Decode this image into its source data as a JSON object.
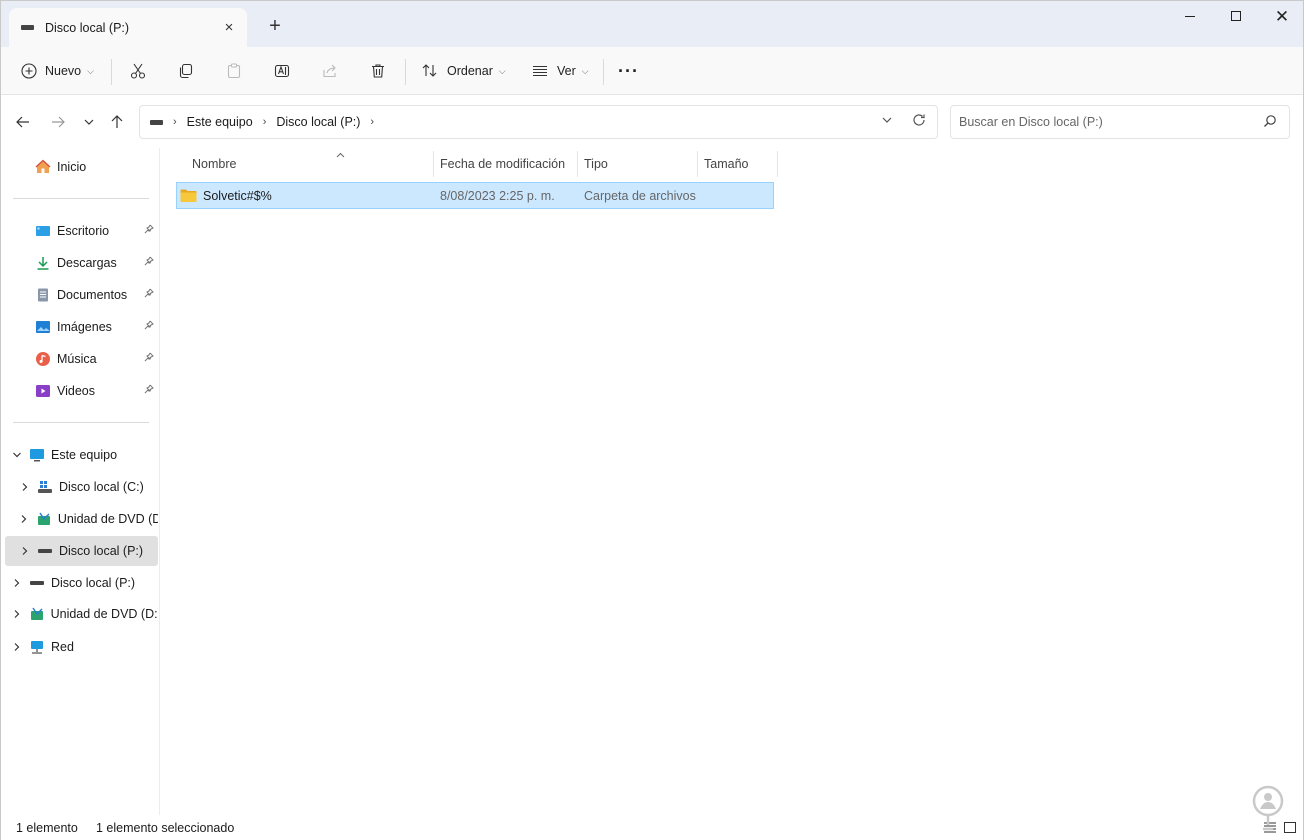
{
  "tab": {
    "title": "Disco local (P:)",
    "close_icon": "×",
    "new_tab_icon": "+"
  },
  "window_controls": {
    "close_glyph": "✕"
  },
  "toolbar": {
    "new_label": "Nuevo",
    "sort_label": "Ordenar",
    "view_label": "Ver",
    "more_glyph": "···"
  },
  "address": {
    "crumbs": [
      "Este equipo",
      "Disco local (P:)"
    ],
    "separator": "›"
  },
  "search": {
    "placeholder": "Buscar en Disco local (P:)"
  },
  "sidebar": {
    "home": "Inicio",
    "quick": [
      {
        "label": "Escritorio"
      },
      {
        "label": "Descargas"
      },
      {
        "label": "Documentos"
      },
      {
        "label": "Imágenes"
      },
      {
        "label": "Música"
      },
      {
        "label": "Videos"
      }
    ],
    "this_pc": "Este equipo",
    "this_pc_children": [
      {
        "label": "Disco local (C:)"
      },
      {
        "label": "Unidad de DVD (D:)"
      },
      {
        "label": "Disco local (P:)"
      }
    ],
    "other": [
      {
        "label": "Disco local (P:)"
      },
      {
        "label": "Unidad de DVD (D:)"
      },
      {
        "label": "Red"
      }
    ]
  },
  "columns": {
    "name": "Nombre",
    "modified": "Fecha de modificación",
    "type": "Tipo",
    "size": "Tamaño"
  },
  "files": [
    {
      "name": "Solvetic#$%",
      "modified": "8/08/2023 2:25 p. m.",
      "type": "Carpeta de archivos",
      "size": ""
    }
  ],
  "status": {
    "count": "1 elemento",
    "selected": "1 elemento seleccionado"
  },
  "colors": {
    "selection": "#cce8ff",
    "selection_border": "#99d1ff",
    "titlebar": "#e9eef6",
    "folder": "#f8c83c"
  }
}
